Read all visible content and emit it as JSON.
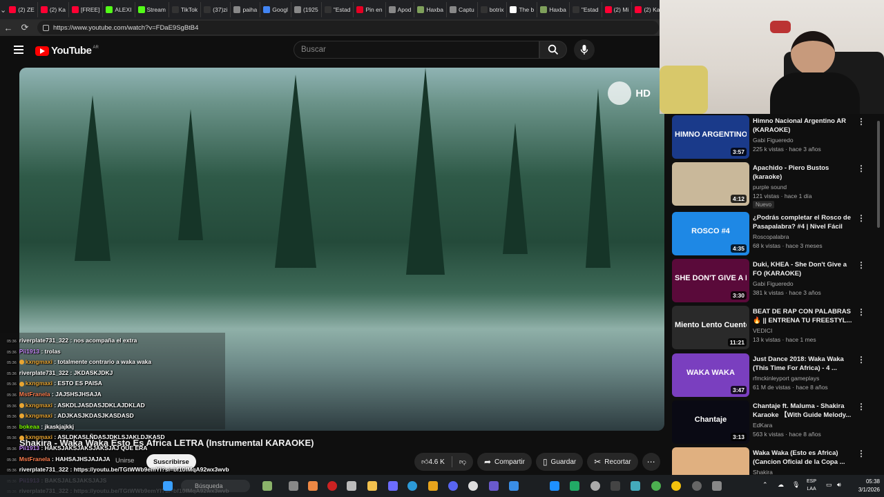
{
  "browser": {
    "tabs": [
      {
        "label": "(2) ZE",
        "color": "#ff0033"
      },
      {
        "label": "(2) Ka",
        "color": "#ff0033"
      },
      {
        "label": "[FREE]",
        "color": "#ff0033"
      },
      {
        "label": "ALEXI",
        "color": "#53fc18"
      },
      {
        "label": "Stream",
        "color": "#53fc18"
      },
      {
        "label": "TikTok",
        "color": "#333333"
      },
      {
        "label": "(37)zi",
        "color": "#333333"
      },
      {
        "label": "paiha",
        "color": "#888888"
      },
      {
        "label": "Googl",
        "color": "#4285f4"
      },
      {
        "label": "(1925",
        "color": "#888888"
      },
      {
        "label": "\"Estad",
        "color": "#333333"
      },
      {
        "label": "Pin en",
        "color": "#e60023"
      },
      {
        "label": "Apod",
        "color": "#888888"
      },
      {
        "label": "Haxba",
        "color": "#7fa05b"
      },
      {
        "label": "Captu",
        "color": "#888888"
      },
      {
        "label": "botrix",
        "color": "#333333"
      },
      {
        "label": "The b",
        "color": "#ffffff"
      },
      {
        "label": "Haxba",
        "color": "#7fa05b"
      },
      {
        "label": "\"Estad",
        "color": "#333333"
      },
      {
        "label": "(2) Mi",
        "color": "#ff0033"
      },
      {
        "label": "(2) Ka",
        "color": "#ff0033"
      }
    ],
    "url": "https://www.youtube.com/watch?v=FDaE9SgBtB4"
  },
  "youtube": {
    "logo_text": "YouTube",
    "country_code": "AR",
    "search_placeholder": "Buscar"
  },
  "video": {
    "hd_label": "HD",
    "title": "Shakira - Waka Waka Esto Es Africa LETRA (Instrumental KARAOKE)",
    "join_label": "Unirse",
    "subscribe_label": "Suscribirse",
    "like_count": "4.6 K",
    "share_label": "Compartir",
    "save_label": "Guardar",
    "clip_label": "Recortar"
  },
  "recommendations": [
    {
      "title": "Himno Nacional Argentino AR (KARAOKE)",
      "channel": "Gabi Figueredo",
      "meta": "225 k vistas · hace 3 años",
      "duration": "3:57",
      "thumb_text": "HIMNO ARGENTINO",
      "thumb_color": "#1a3a8a",
      "new": ""
    },
    {
      "title": "Apachido - Piero Bustos (karaoke)",
      "channel": "purple sound",
      "meta": "121 vistas · hace 1 día",
      "duration": "4:12",
      "thumb_text": "",
      "thumb_color": "#c9b89a",
      "new": "Nuevo"
    },
    {
      "title": "¿Podrás completar el Rosco de Pasapalabra? #4 | Nivel Fácil",
      "channel": "Roscopalabra",
      "meta": "68 k vistas · hace 3 meses",
      "duration": "4:35",
      "thumb_text": "ROSCO #4",
      "thumb_color": "#1e88e5",
      "new": ""
    },
    {
      "title": "Duki, KHEA - She Don't Give a FO (KARAOKE)",
      "channel": "Gabi Figueredo",
      "meta": "381 k vistas · hace 3 años",
      "duration": "3:30",
      "thumb_text": "SHE DON'T GIVE A FO",
      "thumb_color": "#5a0a3a",
      "new": ""
    },
    {
      "title": "BEAT DE RAP CON PALABRAS 🔥 || ENTRENA TU FREESTYL...",
      "channel": "VEDICI",
      "meta": "13 k vistas · hace 1 mes",
      "duration": "11:21",
      "thumb_text": "Miento Lento Cuento Momento",
      "thumb_color": "#2a2a2a",
      "new": ""
    },
    {
      "title": "Just Dance 2018: Waka Waka (This Time For Africa) - 4 ...",
      "channel": "rfmckinleyport gameplays",
      "meta": "61 M de vistas · hace 8 años",
      "duration": "3:47",
      "thumb_text": "WAKA WAKA",
      "thumb_color": "#7a3fbf",
      "new": ""
    },
    {
      "title": "Chantaje ft. Maluma - Shakira Karaoke 【With Guide Melody...",
      "channel": "EdKara",
      "meta": "563 k vistas · hace 8 años",
      "duration": "3:13",
      "thumb_text": "Chantaje",
      "thumb_color": "#0a0a14",
      "new": ""
    },
    {
      "title": "Waka Waka (Esto es Africa) (Cancion Oficial de la Copa ...",
      "channel": "Shakira",
      "meta": "",
      "duration": "",
      "thumb_text": "",
      "thumb_color": "#e0b080",
      "new": ""
    }
  ],
  "chat": [
    {
      "time": "05:36",
      "user": "riverplate731_322",
      "user_color": "#ffffff",
      "badge": false,
      "msg": "nos acompaña el extra"
    },
    {
      "time": "05:36",
      "user": "Pii1913",
      "user_color": "#c58af9",
      "badge": false,
      "msg": "trolas"
    },
    {
      "time": "05:36",
      "user": "kxngmaxi",
      "user_color": "#e9a531",
      "badge": true,
      "msg": "totalmente contrario a waka waka"
    },
    {
      "time": "05:36",
      "user": "riverplate731_322",
      "user_color": "#ffffff",
      "badge": false,
      "msg": "JKDASKJDKJ"
    },
    {
      "time": "05:36",
      "user": "kxngmaxi",
      "user_color": "#e9a531",
      "badge": true,
      "msg": "ESTO ES PAISA"
    },
    {
      "time": "05:36",
      "user": "MstFranela",
      "user_color": "#ff7f50",
      "badge": false,
      "msg": "JAJSHSJHSAJA"
    },
    {
      "time": "05:36",
      "user": "kxngmaxi",
      "user_color": "#e9a531",
      "badge": true,
      "msg": "ASKDLJASDASJDKLAJDKLAD"
    },
    {
      "time": "05:36",
      "user": "kxngmaxi",
      "user_color": "#e9a531",
      "badge": true,
      "msg": "ADJKASJKDASJKASDASD"
    },
    {
      "time": "05:36",
      "user": "bokeaa",
      "user_color": "#7fff00",
      "badge": false,
      "msg": "jkaskjajkkj"
    },
    {
      "time": "05:36",
      "user": "kxngmaxi",
      "user_color": "#e9a531",
      "badge": true,
      "msg": "ASLDKASLÑDASJDKLSJAKLDJKASD"
    },
    {
      "time": "05:36",
      "user": "Pii1913",
      "user_color": "#c58af9",
      "badge": false,
      "msg": "HAKSJAKSJAKSJAKSJAJ QUE ERA"
    },
    {
      "time": "05:36",
      "user": "MstFranela",
      "user_color": "#ff7f50",
      "badge": false,
      "msg": "HAHSAJHSJAJAJA"
    },
    {
      "time": "05:36",
      "user": "riverplate731_322",
      "user_color": "#ffffff",
      "badge": false,
      "msg": "https://youtu.be/TGtWWb9emYI?si=bf10fMqA92wx3wvb"
    },
    {
      "time": "05:36",
      "user": "Pii1913",
      "user_color": "#c58af9",
      "badge": false,
      "msg": "BAKSJALSJAKSJAJS"
    },
    {
      "time": "05:36",
      "user": "riverplate731_322",
      "user_color": "#ffffff",
      "badge": false,
      "msg": "https://youtu.be/TGtWWb9emYI?si=bf10fMqA92wx3wvb"
    }
  ],
  "taskbar": {
    "search_placeholder": "Búsqueda",
    "lang": "ESP",
    "lang_sub": "LAA",
    "time": "05:38",
    "date": "3/1/2026"
  }
}
